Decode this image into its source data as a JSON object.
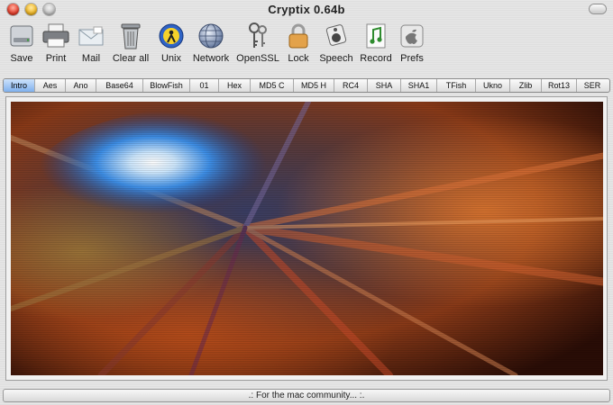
{
  "window": {
    "title": "Cryptix 0.64b"
  },
  "toolbar": {
    "items": [
      {
        "label": "Save",
        "icon": "hard-drive-icon"
      },
      {
        "label": "Print",
        "icon": "printer-icon"
      },
      {
        "label": "Mail",
        "icon": "envelope-icon"
      },
      {
        "label": "Clear all",
        "icon": "trash-can-icon"
      },
      {
        "label": "Unix",
        "icon": "unix-globe-icon"
      },
      {
        "label": "Network",
        "icon": "network-globe-icon"
      },
      {
        "label": "OpenSSL",
        "icon": "keys-icon"
      },
      {
        "label": "Lock",
        "icon": "padlock-icon"
      },
      {
        "label": "Speech",
        "icon": "speaker-icon"
      },
      {
        "label": "Record",
        "icon": "music-document-icon"
      },
      {
        "label": "Prefs",
        "icon": "apple-prefs-icon"
      }
    ]
  },
  "tabs": [
    "Intro",
    "Aes",
    "Ano",
    "Base64",
    "BlowFish",
    "01",
    "Hex",
    "MD5 C",
    "MD5 H",
    "RC4",
    "SHA",
    "SHA1",
    "TFish",
    "Ukno",
    "Zlib",
    "Rot13",
    "SER"
  ],
  "active_tab": "Intro",
  "status": {
    "text": ".: For the mac community... :."
  }
}
